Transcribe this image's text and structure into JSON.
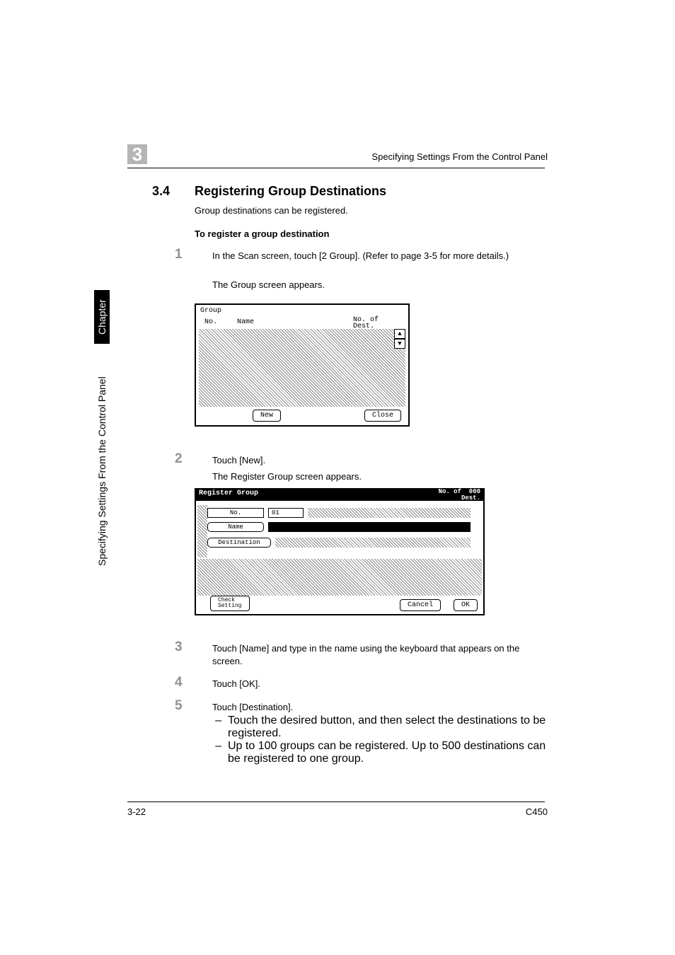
{
  "header": {
    "chapter_badge": "3",
    "running_title": "Specifying Settings From the Control Panel"
  },
  "side": {
    "chapter_label": "Chapter 3",
    "section_label": "Specifying Settings From the Control Panel"
  },
  "section": {
    "number": "3.4",
    "title": "Registering Group Destinations",
    "intro": "Group destinations can be registered.",
    "subhead": "To register a group destination"
  },
  "steps": {
    "s1": {
      "num": "1",
      "text": "In the Scan screen, touch [2 Group]. (Refer to page 3-5 for more details.)",
      "after": "The Group screen appears."
    },
    "s2": {
      "num": "2",
      "text": "Touch [New].",
      "after": "The Register Group screen appears."
    },
    "s3": {
      "num": "3",
      "text": "Touch [Name] and type in the name using the keyboard that appears on the screen."
    },
    "s4": {
      "num": "4",
      "text": "Touch [OK]."
    },
    "s5": {
      "num": "5",
      "text": "Touch [Destination].",
      "b1": "Touch the desired button, and then select the destinations to be registered.",
      "b2": "Up to 100 groups can be registered. Up to 500 destinations can be registered to one group."
    }
  },
  "screen1": {
    "title": "Group",
    "col_no": "No.",
    "col_name": "Name",
    "col_dest_l1": "No. of",
    "col_dest_l2": "Dest.",
    "btn_new": "New",
    "btn_close": "Close"
  },
  "screen2": {
    "title": "Register Group",
    "count_l1": "No. of",
    "count_l2": "Dest.",
    "count_val": "000",
    "row_no_label": "No.",
    "row_no_value": "01",
    "row_name_label": "Name",
    "row_dest_label": "Destination",
    "btn_check_l1": "Check",
    "btn_check_l2": "Setting",
    "btn_cancel": "Cancel",
    "btn_ok": "OK"
  },
  "footer": {
    "left": "3-22",
    "right": "C450"
  }
}
